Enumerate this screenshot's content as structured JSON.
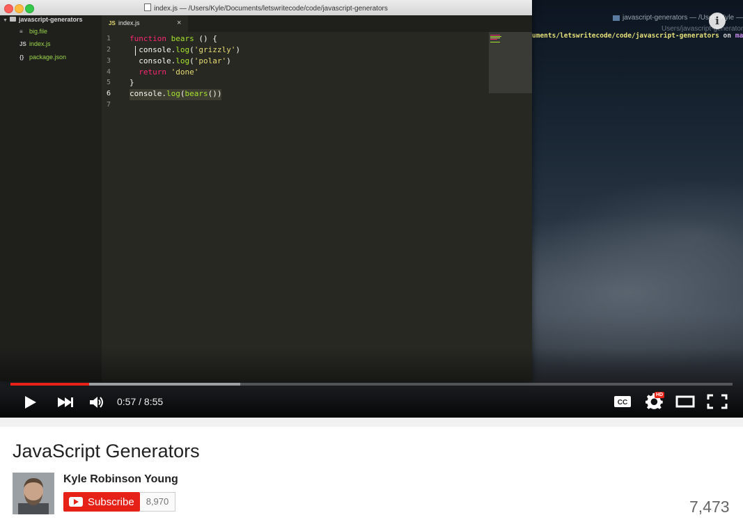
{
  "editor": {
    "window_title": "index.js — /Users/Kyle/Documents/letswritecode/code/javascript-generators",
    "tree": {
      "folder": "javascript-generators",
      "files": [
        {
          "icon": "≡",
          "name": "big.file"
        },
        {
          "icon": "JS",
          "name": "index.js"
        },
        {
          "icon": "{}",
          "name": "package.json"
        }
      ]
    },
    "tab": {
      "badge": "JS",
      "label": "index.js",
      "close": "×"
    },
    "line_numbers": [
      "1",
      "2",
      "3",
      "4",
      "5",
      "6",
      "7"
    ],
    "code": {
      "l1_kw": "function",
      "l1_fn": "bears",
      "l1_rest": " () {",
      "l2_obj": "console.",
      "l2_fn": "log",
      "l2_open": "(",
      "l2_str": "'grizzly'",
      "l2_close": ")",
      "l3_obj": "console.",
      "l3_fn": "log",
      "l3_open": "(",
      "l3_str": "'polar'",
      "l3_close": ")",
      "l4_kw": "return",
      "l4_str": "'done'",
      "l5": "}",
      "l6_obj": "console.",
      "l6_fn": "log",
      "l6_open": "(",
      "l6_call": "bears",
      "l6_close": "())"
    }
  },
  "terminal": {
    "title": "javascript-generators — /Users/Kyle —",
    "subtitle": "Users/javascript-generators",
    "prompt_path": "uments/letswritecode/code/javascript-generators",
    "prompt_on": " on ",
    "prompt_branch": "master*"
  },
  "player": {
    "time": "0:57 / 8:55",
    "played_fraction": 0.109,
    "buffered_fraction": 0.318,
    "cc_label": "CC",
    "hd_badge": "HD",
    "info_label": "i"
  },
  "video": {
    "title": "JavaScript Generators",
    "channel": "Kyle Robinson Young",
    "subscribe_label": "Subscribe",
    "subscriber_count": "8,970",
    "views": "7,473"
  },
  "colors": {
    "accent_red": "#e62117",
    "editor_bg": "#272822",
    "keyword": "#f92672",
    "function": "#a6e22e",
    "string": "#e6db74"
  }
}
